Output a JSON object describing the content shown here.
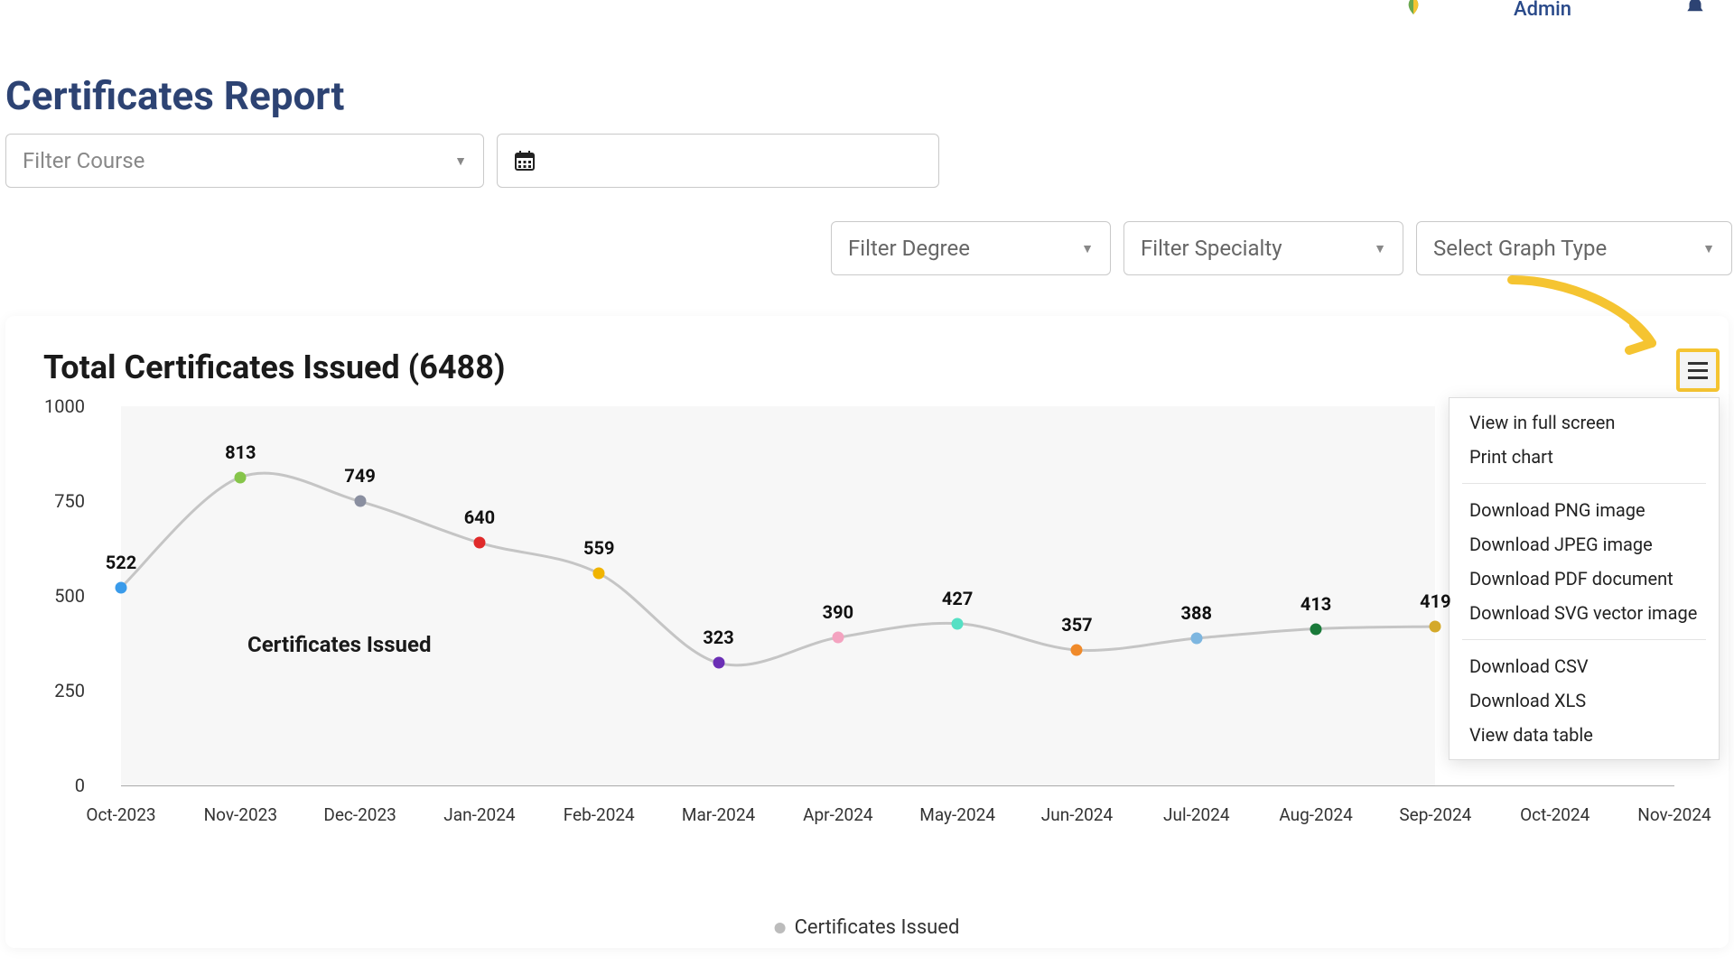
{
  "header": {
    "admin_label": "Admin"
  },
  "page": {
    "title": "Certificates Report"
  },
  "filters": {
    "course_placeholder": "Filter Course",
    "degree_placeholder": "Filter Degree",
    "specialty_placeholder": "Filter Specialty",
    "graph_type_placeholder": "Select Graph Type"
  },
  "chart": {
    "title": "Total Certificates Issued (6488)",
    "series_inline_label": "Certificates Issued",
    "legend_label": "Certificates Issued"
  },
  "menu": {
    "view_full": "View in full screen",
    "print": "Print chart",
    "dl_png": "Download PNG image",
    "dl_jpeg": "Download JPEG image",
    "dl_pdf": "Download PDF document",
    "dl_svg": "Download SVG vector image",
    "dl_csv": "Download CSV",
    "dl_xls": "Download XLS",
    "view_table": "View data table"
  },
  "chart_data": {
    "type": "line",
    "title": "Total Certificates Issued (6488)",
    "xlabel": "",
    "ylabel": "",
    "ylim": [
      0,
      1000
    ],
    "y_ticks": [
      0,
      250,
      500,
      750,
      1000
    ],
    "categories": [
      "Oct-2023",
      "Nov-2023",
      "Dec-2023",
      "Jan-2024",
      "Feb-2024",
      "Mar-2024",
      "Apr-2024",
      "May-2024",
      "Jun-2024",
      "Jul-2024",
      "Aug-2024",
      "Sep-2024",
      "Oct-2024",
      "Nov-2024"
    ],
    "series": [
      {
        "name": "Certificates Issued",
        "values": [
          522,
          813,
          749,
          640,
          559,
          323,
          390,
          427,
          357,
          388,
          413,
          419,
          null,
          null
        ],
        "point_colors": [
          "#3a9bea",
          "#86c54a",
          "#8a8fa0",
          "#e02a2a",
          "#f0b400",
          "#6b2fb5",
          "#f4a3c0",
          "#55e0c4",
          "#f08a2a",
          "#7db6e0",
          "#1a7a3a",
          "#d4a92a",
          "",
          ""
        ]
      }
    ]
  }
}
